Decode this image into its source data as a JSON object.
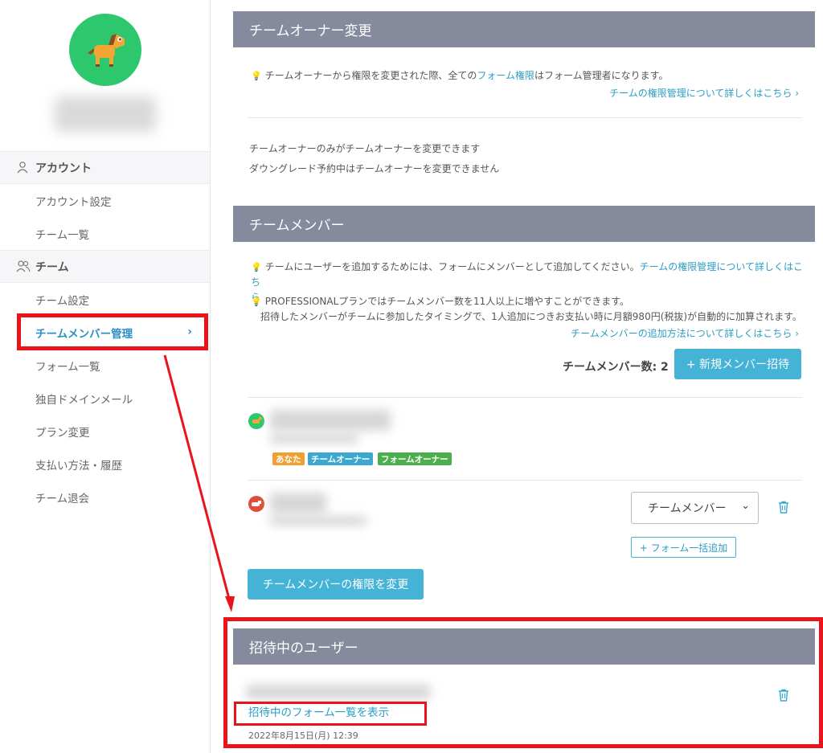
{
  "sidebar": {
    "account_section": "アカウント",
    "team_section": "チーム",
    "items": [
      {
        "label": "アカウント設定"
      },
      {
        "label": "チーム一覧"
      },
      {
        "label": "チーム設定"
      },
      {
        "label": "チームメンバー管理"
      },
      {
        "label": "フォーム一覧"
      },
      {
        "label": "独自ドメインメール"
      },
      {
        "label": "プラン変更"
      },
      {
        "label": "支払い方法・履歴"
      },
      {
        "label": "チーム退会"
      }
    ],
    "active_chevron": "›"
  },
  "owner_section": {
    "title": "チームオーナー変更",
    "tip_before": "チームオーナーから権限を変更された際、全ての",
    "tip_link": "フォーム権限",
    "tip_after": "はフォーム管理者になります。",
    "more_link": "チームの権限管理について詳しくはこちら ›",
    "note1": "チームオーナーのみがチームオーナーを変更できます",
    "note2": "ダウングレード予約中はチームオーナーを変更できません"
  },
  "members_section": {
    "title": "チームメンバー",
    "tip1_text": "チームにユーザーを追加するためには、フォームにメンバーとして追加してください。",
    "tip1_link_a": "チームの権限管理について詳しくはこち",
    "tip1_link_b": "ら",
    "tip2_line1": "PROFESSIONALプランではチームメンバー数を11人以上に増やすことができます。",
    "tip2_line2": "招待したメンバーがチームに参加したタイミングで、1人追加につきお支払い時に月額980円(税抜)が自動的に加算されます。",
    "more_link": "チームメンバーの追加方法について詳しくはこちら ›",
    "member_count_label": "チームメンバー数: 2",
    "invite_button": "+ 新規メンバー招待",
    "badges": [
      "あなた",
      "チームオーナー",
      "フォームオーナー"
    ],
    "role_select_value": "チームメンバー",
    "bulk_add_button": "+ フォーム一括追加",
    "change_role_button": "チームメンバーの権限を変更"
  },
  "invited_section": {
    "title": "招待中のユーザー",
    "forms_link": "招待中のフォーム一覧を表示",
    "date": "2022年8月15日(月) 12:39"
  },
  "colors": {
    "header_bg": "#868a9d",
    "accent": "#44b3d6",
    "link": "#2b9ec4",
    "highlight_red": "#e8141a",
    "badge_you": "#f0a030",
    "badge_team_owner": "#3aa8cf",
    "badge_form_owner": "#4cae4c",
    "avatar_bg": "#2dc76d"
  }
}
